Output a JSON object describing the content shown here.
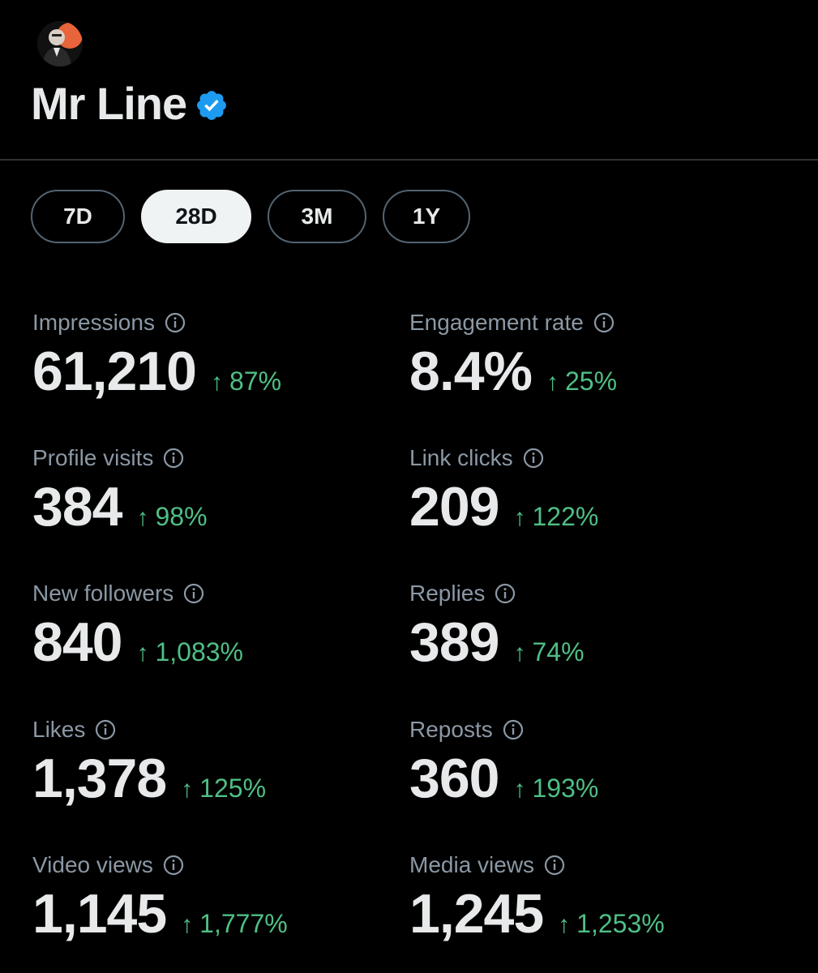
{
  "profile": {
    "name": "Mr Line",
    "verified_color": "#1d9bf0"
  },
  "range_tabs": [
    {
      "label": "7D",
      "active": false
    },
    {
      "label": "28D",
      "active": true
    },
    {
      "label": "3M",
      "active": false
    },
    {
      "label": "1Y",
      "active": false
    }
  ],
  "metrics": [
    {
      "label": "Impressions",
      "value": "61,210",
      "change": "87%",
      "direction": "up"
    },
    {
      "label": "Engagement rate",
      "value": "8.4%",
      "change": "25%",
      "direction": "up"
    },
    {
      "label": "Profile visits",
      "value": "384",
      "change": "98%",
      "direction": "up"
    },
    {
      "label": "Link clicks",
      "value": "209",
      "change": "122%",
      "direction": "up"
    },
    {
      "label": "New followers",
      "value": "840",
      "change": "1,083%",
      "direction": "up"
    },
    {
      "label": "Replies",
      "value": "389",
      "change": "74%",
      "direction": "up"
    },
    {
      "label": "Likes",
      "value": "1,378",
      "change": "125%",
      "direction": "up"
    },
    {
      "label": "Reposts",
      "value": "360",
      "change": "193%",
      "direction": "up"
    },
    {
      "label": "Video views",
      "value": "1,145",
      "change": "1,777%",
      "direction": "up"
    },
    {
      "label": "Media views",
      "value": "1,245",
      "change": "1,253%",
      "direction": "up"
    }
  ],
  "icons": {
    "avatar": "avatar",
    "verified": "verified-badge-icon",
    "info": "info-icon",
    "arrow": "arrow-up-icon"
  },
  "colors": {
    "positive": "#4fbf85",
    "label": "#8b98a5",
    "accent": "#1d9bf0"
  }
}
